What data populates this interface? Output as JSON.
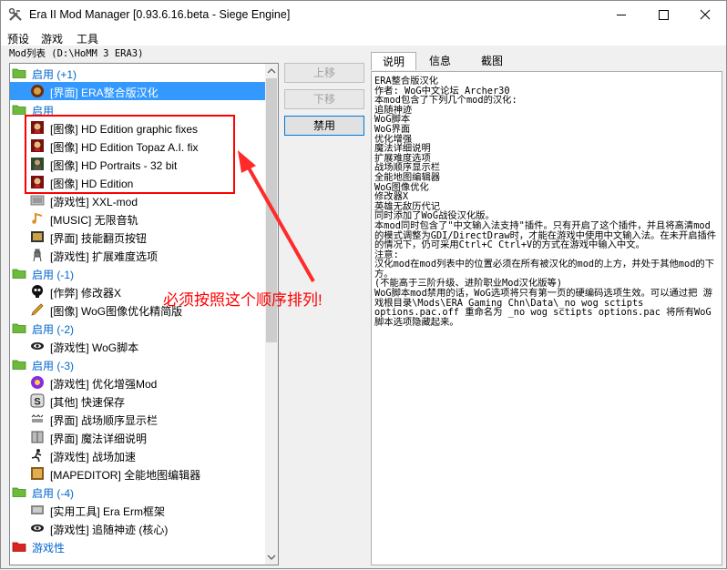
{
  "window": {
    "title": "Era II Mod Manager [0.93.6.16.beta - Siege Engine]"
  },
  "menu": [
    "预设",
    "游戏",
    "工具"
  ],
  "mods_path": "Mod列表 (D:\\HoMM 3 ERA3)",
  "mod_list": [
    {
      "type": "group",
      "label": "启用 (+1)",
      "icon": "green-folder-icon"
    },
    {
      "type": "mod",
      "label": "[界面] ERA整合版汉化",
      "icon": "round-emblem-icon",
      "selected": true
    },
    {
      "type": "group",
      "label": "启用",
      "icon": "green-folder-icon"
    },
    {
      "type": "mod",
      "label": "[图像] HD Edition graphic fixes",
      "icon": "hd-edition-icon"
    },
    {
      "type": "mod",
      "label": "[图像] HD Edition Topaz A.I. fix",
      "icon": "hd-edition-icon"
    },
    {
      "type": "mod",
      "label": "[图像] HD Portraits - 32 bit",
      "icon": "portrait-icon"
    },
    {
      "type": "mod",
      "label": "[图像] HD Edition",
      "icon": "hd-edition-icon"
    },
    {
      "type": "mod",
      "label": "[游戏性] XXL-mod",
      "icon": "xxl-map-icon"
    },
    {
      "type": "mod",
      "label": "[MUSIC] 无限音轨",
      "icon": "music-note-icon"
    },
    {
      "type": "mod",
      "label": "[界面] 技能翻页按钮",
      "icon": "skill-button-icon"
    },
    {
      "type": "mod",
      "label": "[游戏性] 扩展难度选项",
      "icon": "knight-icon"
    },
    {
      "type": "group",
      "label": "启用 (-1)",
      "icon": "green-folder-icon"
    },
    {
      "type": "mod",
      "label": "[作弊] 修改器X",
      "icon": "skull-icon"
    },
    {
      "type": "mod",
      "label": "[图像] WoG图像优化精简版",
      "icon": "pen-icon"
    },
    {
      "type": "group",
      "label": "启用 (-2)",
      "icon": "green-folder-icon"
    },
    {
      "type": "mod",
      "label": "[游戏性] WoG脚本",
      "icon": "wog-eye-icon"
    },
    {
      "type": "group",
      "label": "启用 (-3)",
      "icon": "green-folder-icon"
    },
    {
      "type": "mod",
      "label": "[游戏性] 优化增强Mod",
      "icon": "enhance-icon"
    },
    {
      "type": "mod",
      "label": "[其他] 快速保存",
      "icon": "save-s-icon"
    },
    {
      "type": "mod",
      "label": "[界面] 战场顺序显示栏",
      "icon": "battle-queue-icon"
    },
    {
      "type": "mod",
      "label": "[界面] 魔法详细说明",
      "icon": "spellbook-icon"
    },
    {
      "type": "mod",
      "label": "[游戏性] 战场加速",
      "icon": "runner-icon"
    },
    {
      "type": "mod",
      "label": "[MAPEDITOR] 全能地图编辑器",
      "icon": "map-editor-icon"
    },
    {
      "type": "group",
      "label": "启用 (-4)",
      "icon": "green-folder-icon"
    },
    {
      "type": "mod",
      "label": "[实用工具] Era Erm框架",
      "icon": "erm-icon"
    },
    {
      "type": "mod",
      "label": "[游戏性] 追随神迹 (核心)",
      "icon": "wog-eye-icon"
    },
    {
      "type": "group-disabled",
      "label": "游戏性",
      "icon": "red-folder-icon"
    }
  ],
  "buttons": {
    "move_up": "上移",
    "move_down": "下移",
    "disable": "禁用"
  },
  "tabs": [
    "说明",
    "信息",
    "截图"
  ],
  "description": [
    "ERA整合版汉化",
    "",
    "作者: WoG中文论坛 Archer30",
    "",
    "本mod包含了下列几个mod的汉化:\n追随神迹\nWoG脚本\nWoG界面\n优化增强\n魔法详细说明\n扩展难度选项\n战场顺序显示栏\n全能地图编辑器\nWoG图像优化\n修改器X\n英雄无敌历代记\n同时添加了WoG战役汉化版。",
    "",
    "本mod同时包含了\"中文输入法支持\"插件。只有开启了这个插件，并且将高清mod的模式调整为GDI/DirectDraw时，才能在游戏中使用中文输入法。在未开启插件的情况下，仍可采用Ctrl+C Ctrl+V的方式在游戏中输入中文。",
    "",
    "注意:\n汉化mod在mod列表中的位置必须在所有被汉化的mod的上方，并处于其他mod的下方。\n(不能高于三阶升级、进阶职业Mod汉化版等)",
    "",
    "WoG脚本mod禁用的话，WoG选项将只有第一页的硬编码选项生效。可以通过把 游戏根目录\\Mods\\ERA Gaming Chn\\Data\\_no wog sctipts options.pac.off 重命名为 _no wog sctipts options.pac 将所有WoG脚本选项隐藏起来。"
  ],
  "annotation": {
    "text": "必须按照这个顺序排列!",
    "color": "#ff0000"
  },
  "colors": {
    "group_text": "#0066cc",
    "selection": "#3399ff",
    "annotation": "#ff0000"
  }
}
